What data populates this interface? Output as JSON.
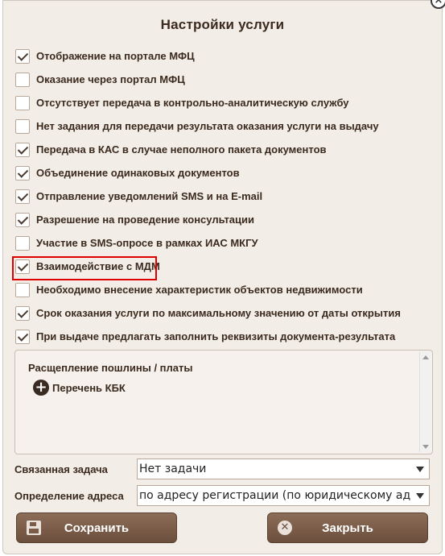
{
  "dialog": {
    "title": "Настройки услуги"
  },
  "options": [
    {
      "label": "Отображение на портале МФЦ",
      "checked": true
    },
    {
      "label": "Оказание через портал МФЦ",
      "checked": false
    },
    {
      "label": "Отсутствует передача в контрольно-аналитическую службу",
      "checked": false
    },
    {
      "label": "Нет задания для передачи результата оказания услуги на выдачу",
      "checked": false
    },
    {
      "label": "Передача в КАС в случае неполного пакета документов",
      "checked": true
    },
    {
      "label": "Объединение одинаковых документов",
      "checked": true
    },
    {
      "label": "Отправление уведомлений SMS и на E-mail",
      "checked": true
    },
    {
      "label": "Разрешение на проведение консультации",
      "checked": true
    },
    {
      "label": "Участие в SMS-опросе в рамках ИАС МКГУ",
      "checked": false
    },
    {
      "label": "Взаимодействие с МДМ",
      "checked": true,
      "highlighted": true
    },
    {
      "label": "Необходимо внесение характеристик объектов недвижимости",
      "checked": false
    },
    {
      "label": "Срок оказания услуги по максимальному значению от даты открытия",
      "checked": true
    },
    {
      "label": "При выдаче предлагать заполнить реквизиты документа-результата",
      "checked": true
    }
  ],
  "fee_panel": {
    "title": "Расщепление пошлины / платы",
    "kbk_label": "Перечень КБК"
  },
  "related_task": {
    "label": "Связанная задача",
    "value": "Нет задачи"
  },
  "address": {
    "label": "Определение адреса",
    "value": "по адресу регистрации (по юридическому адресу)"
  },
  "buttons": {
    "save": "Сохранить",
    "close": "Закрыть"
  },
  "colors": {
    "dialog_bg": "#f3ede7",
    "button": "#7a5c48",
    "highlight": "#e00000"
  }
}
